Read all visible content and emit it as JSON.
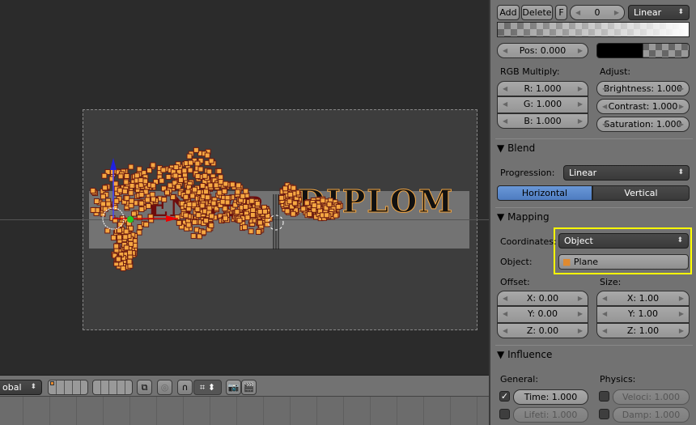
{
  "viewport": {
    "scene_text_left": "ENDER",
    "scene_text_right": "DIPLOM"
  },
  "toolbar": {
    "orientation_value": "obal",
    "icons": [
      "layer-grid-icon",
      "layer-grid-icon",
      "lock-camera-icon",
      "proportional-edit-icon",
      "snap-magnet-icon",
      "snap-target-icon",
      "render-icon",
      "render-animation-icon"
    ]
  },
  "ramp": {
    "add": "Add",
    "delete": "Delete",
    "flip": "F",
    "index": "0",
    "interpolation": "Linear",
    "pos": "Pos: 0.000"
  },
  "rgb_multiply": {
    "label": "RGB Multiply:",
    "r": "R: 1.000",
    "g": "G: 1.000",
    "b": "B: 1.000"
  },
  "adjust": {
    "label": "Adjust:",
    "brightness": "Brightness: 1.000",
    "contrast": "Contrast: 1.000",
    "saturation": "Saturation: 1.000"
  },
  "blend": {
    "title": "Blend",
    "progression_label": "Progression:",
    "progression_value": "Linear",
    "horizontal": "Horizontal",
    "vertical": "Vertical",
    "active": "Horizontal"
  },
  "mapping": {
    "title": "Mapping",
    "coordinates_label": "Coordinates:",
    "coordinates_value": "Object",
    "object_label": "Object:",
    "object_value": "Plane",
    "highlight_color": "#ffff00"
  },
  "offset": {
    "label": "Offset:",
    "x": "X: 0.00",
    "y": "Y: 0.00",
    "z": "Z: 0.00"
  },
  "size": {
    "label": "Size:",
    "x": "X: 1.00",
    "y": "Y: 1.00",
    "z": "Z: 1.00"
  },
  "influence": {
    "title": "Influence",
    "general_label": "General:",
    "physics_label": "Physics:",
    "time": "Time: 1.000",
    "time_checked": true,
    "lifetime": "Lifeti: 1.000",
    "lifetime_checked": false,
    "velocity": "Veloci: 1.000",
    "velocity_checked": false,
    "damp": "Damp: 1.000",
    "damp_checked": false
  },
  "colors": {
    "particle": "#f5a742",
    "selected_blue": "#5680c2",
    "accent_highlight": "#ffff00"
  }
}
